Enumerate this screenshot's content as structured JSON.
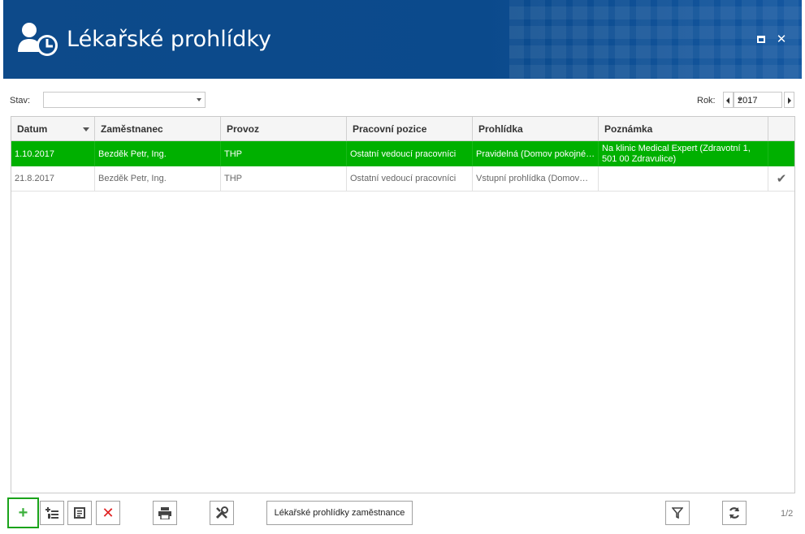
{
  "window": {
    "title": "Lékařské prohlídky",
    "maximize_icon": "maximize-icon",
    "close_symbol": "✕"
  },
  "filters": {
    "stav_label": "Stav:",
    "stav_value": "",
    "rok_label": "Rok:",
    "rok_value": "2017"
  },
  "table": {
    "columns": [
      "Datum",
      "Zaměstnanec",
      "Provoz",
      "Pracovní pozice",
      "Prohlídka",
      "Poznámka"
    ],
    "sort_column": "Datum",
    "rows": [
      {
        "datum": "1.10.2017",
        "zamestnanec": "Bezděk Petr, Ing.",
        "provoz": "THP",
        "pozice": "Ostatní vedoucí pracovníci",
        "prohlidka": "Pravidelná (Domov pokojné…",
        "poznamka": "Na klinic Medical Expert (Zdravotní 1, 501 00 Zdravulice)",
        "done": "",
        "selected": true
      },
      {
        "datum": "21.8.2017",
        "zamestnanec": "Bezděk Petr, Ing.",
        "provoz": "THP",
        "pozice": "Ostatní vedoucí pracovníci",
        "prohlidka": "Vstupní prohlídka (Domov…",
        "poznamka": "",
        "done": "✔",
        "selected": false
      }
    ]
  },
  "toolbar": {
    "add_symbol": "+",
    "delete_symbol": "✕",
    "employee_exams_label": "Lékařské prohlídky zaměstnance"
  },
  "pager": {
    "text": "1/2"
  },
  "colors": {
    "header_bg": "#0b4a8c",
    "selected_row": "#00b000",
    "add_button_border": "#1aa31a",
    "delete_red": "#e02020"
  }
}
